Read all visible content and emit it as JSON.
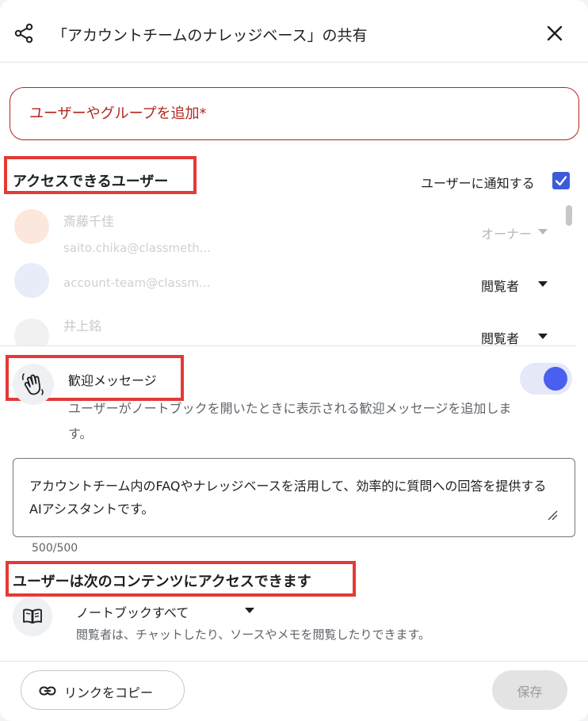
{
  "dialog": {
    "title": "「アカウントチームのナレッジベース」の共有",
    "share_icon": "share-icon",
    "close_icon": "close-icon"
  },
  "add_users": {
    "placeholder": "ユーザーやグループを追加*"
  },
  "access": {
    "heading": "アクセスできるユーザー",
    "notify_label": "ユーザーに通知する",
    "notify_checked": true,
    "users": [
      {
        "name": "斎藤千佳",
        "email": "saito.chika@classmeth...",
        "role": "オーナー",
        "role_disabled": true
      },
      {
        "name": "",
        "email": "account-team@classm...",
        "role": "閲覧者",
        "role_disabled": false
      },
      {
        "name": "井上銘",
        "email": "",
        "role": "閲覧者",
        "role_disabled": false
      }
    ]
  },
  "welcome": {
    "icon": "wave-icon",
    "label": "歓迎メッセージ",
    "enabled": true,
    "description": "ユーザーがノートブックを開いたときに表示される歓迎メッセージを追加します。",
    "message": "アカウントチーム内のFAQやナレッジベースを活用して、効率的に質問への回答を提供するAIアシスタントです。",
    "counter": "500/500"
  },
  "content_access": {
    "heading": "ユーザーは次のコンテンツにアクセスできます",
    "icon": "book-icon",
    "selected": "ノートブックすべて",
    "description": "閲覧者は、チャットしたり、ソースやメモを閲覧したりできます。"
  },
  "footer": {
    "copy_link_label": "リンクをコピー",
    "save_label": "保存"
  },
  "colors": {
    "accent": "#4a5ef0",
    "error": "#b3261e",
    "highlight": "#e53935"
  }
}
